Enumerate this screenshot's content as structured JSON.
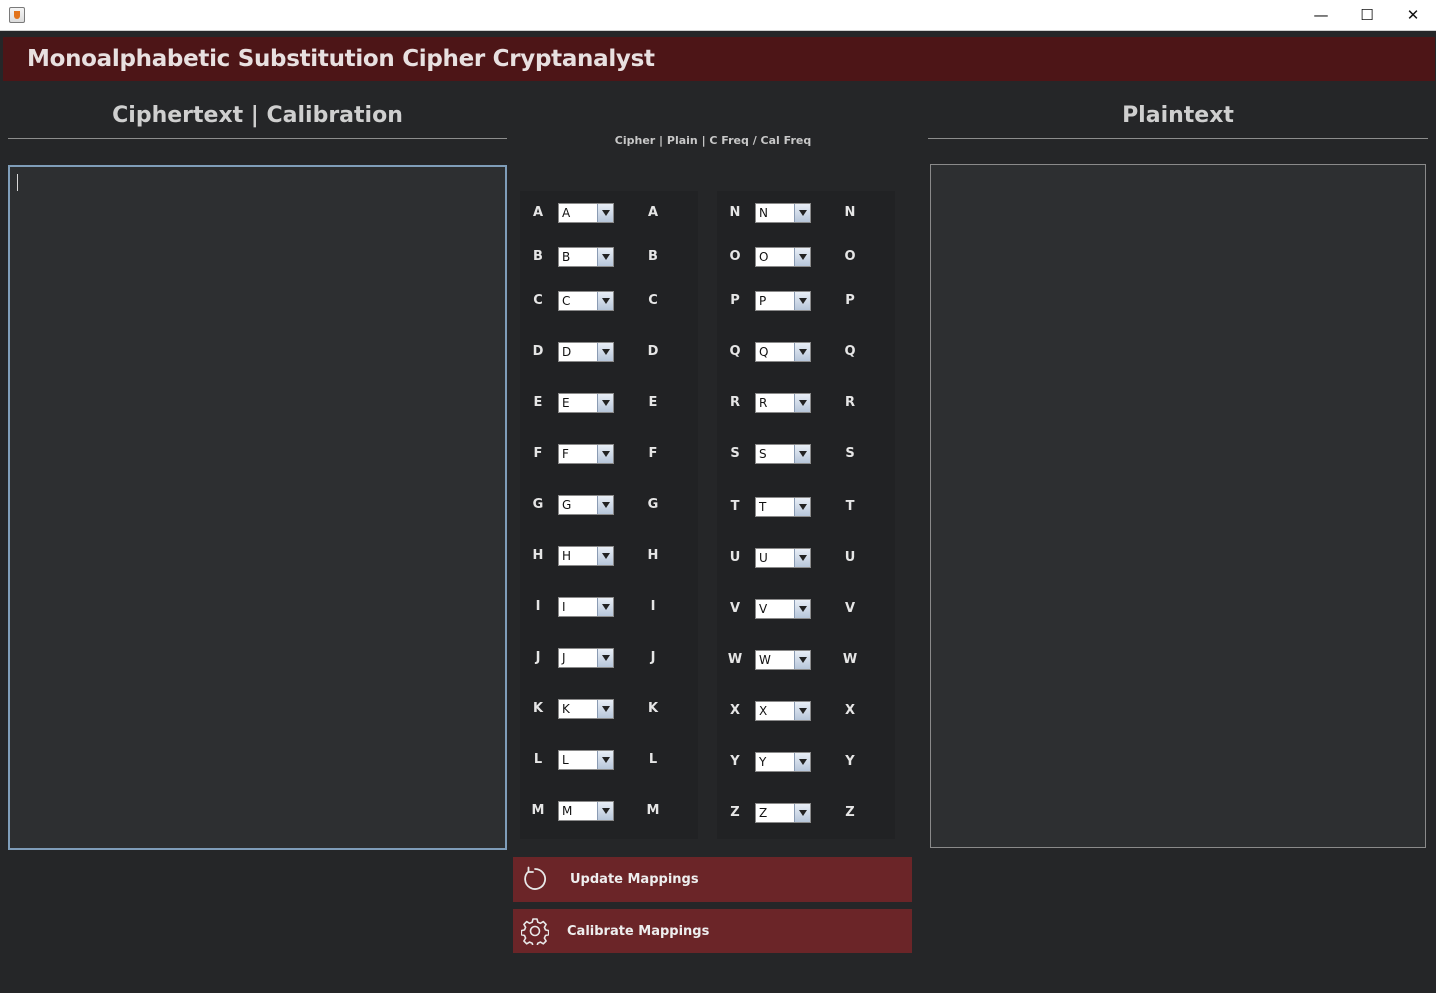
{
  "window": {
    "app_icon": "java-coffee-cup-icon",
    "controls": {
      "minimize": "—",
      "maximize": "☐",
      "close": "✕"
    }
  },
  "header": {
    "title": "Monoalphabetic Substitution Cipher Cryptanalyst",
    "background": "#4d1517"
  },
  "ciphertext_panel": {
    "title": "Ciphertext | Calibration",
    "text": ""
  },
  "plaintext_panel": {
    "title": "Plaintext",
    "text": ""
  },
  "mapping": {
    "caption": "Cipher | Plain | C Freq / Cal Freq",
    "left_rows": [
      {
        "cipher": "A",
        "selected": "A",
        "plain": "A"
      },
      {
        "cipher": "B",
        "selected": "B",
        "plain": "B"
      },
      {
        "cipher": "C",
        "selected": "C",
        "plain": "C"
      },
      {
        "cipher": "D",
        "selected": "D",
        "plain": "D"
      },
      {
        "cipher": "E",
        "selected": "E",
        "plain": "E"
      },
      {
        "cipher": "F",
        "selected": "F",
        "plain": "F"
      },
      {
        "cipher": "G",
        "selected": "G",
        "plain": "G"
      },
      {
        "cipher": "H",
        "selected": "H",
        "plain": "H"
      },
      {
        "cipher": "I",
        "selected": "I",
        "plain": "I"
      },
      {
        "cipher": "J",
        "selected": "J",
        "plain": "J"
      },
      {
        "cipher": "K",
        "selected": "K",
        "plain": "K"
      },
      {
        "cipher": "L",
        "selected": "L",
        "plain": "L"
      },
      {
        "cipher": "M",
        "selected": "M",
        "plain": "M"
      }
    ],
    "right_rows": [
      {
        "cipher": "N",
        "selected": "N",
        "plain": "N"
      },
      {
        "cipher": "O",
        "selected": "O",
        "plain": "O"
      },
      {
        "cipher": "P",
        "selected": "P",
        "plain": "P"
      },
      {
        "cipher": "Q",
        "selected": "Q",
        "plain": "Q"
      },
      {
        "cipher": "R",
        "selected": "R",
        "plain": "R"
      },
      {
        "cipher": "S",
        "selected": "S",
        "plain": "S"
      },
      {
        "cipher": "T",
        "selected": "T",
        "plain": "T"
      },
      {
        "cipher": "U",
        "selected": "U",
        "plain": "U"
      },
      {
        "cipher": "V",
        "selected": "V",
        "plain": "V"
      },
      {
        "cipher": "W",
        "selected": "W",
        "plain": "W"
      },
      {
        "cipher": "X",
        "selected": "X",
        "plain": "X"
      },
      {
        "cipher": "Y",
        "selected": "Y",
        "plain": "Y"
      },
      {
        "cipher": "Z",
        "selected": "Z",
        "plain": "Z"
      }
    ]
  },
  "buttons": {
    "update": {
      "label": "Update Mappings",
      "icon": "refresh-icon"
    },
    "calibrate": {
      "label": "Calibrate Mappings",
      "icon": "gear-icon"
    },
    "background": "#6b2528"
  }
}
